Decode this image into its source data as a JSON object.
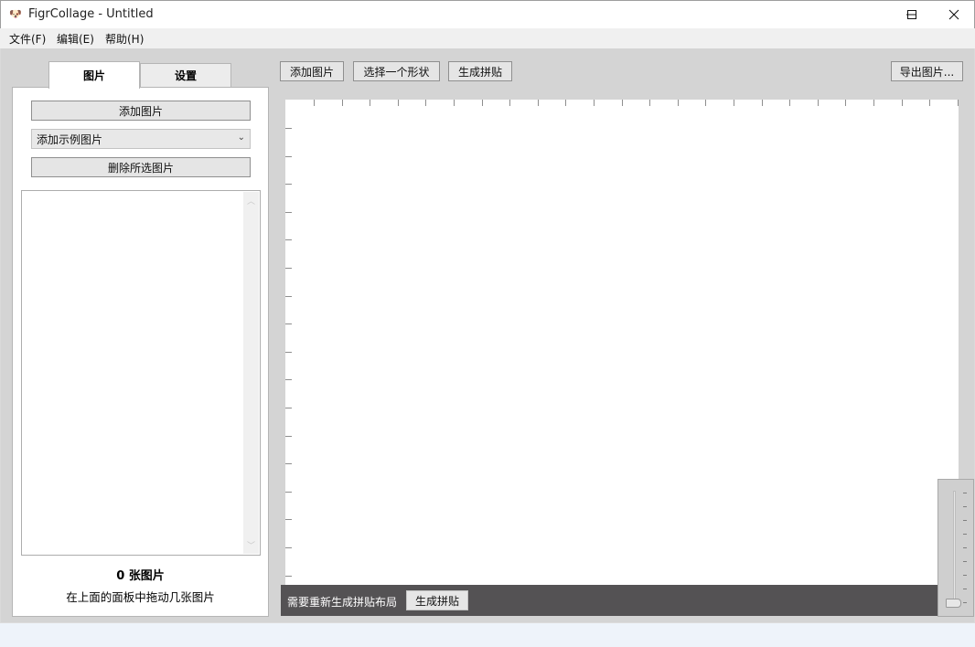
{
  "window": {
    "title": "FigrCollage - Untitled",
    "app_icon": "collage-app-icon",
    "minimize_glyph": "minimize-icon",
    "maximize_glyph": "maximize-icon",
    "close_glyph": "close-icon"
  },
  "menu": {
    "file": "文件(F)",
    "edit": "编辑(E)",
    "help": "帮助(H)"
  },
  "left_panel": {
    "tabs": [
      {
        "label": "图片",
        "active": true
      },
      {
        "label": "设置",
        "active": false
      }
    ],
    "add_image_button": "添加图片",
    "sample_select_value": "添加示例图片",
    "delete_selected_button": "删除所选图片",
    "image_count": "0 张图片",
    "drag_hint": "在上面的面板中拖动几张图片"
  },
  "toolbar": {
    "add_image": "添加图片",
    "select_shape": "选择一个形状",
    "generate_collage": "生成拼贴",
    "export_image": "导出图片..."
  },
  "status": {
    "message": "需要重新生成拼贴布局",
    "generate_button": "生成拼贴"
  },
  "colors": {
    "status_bar_bg": "#545254",
    "canvas_bg": "#ffffff",
    "panel_bg": "#d4d4d4"
  }
}
